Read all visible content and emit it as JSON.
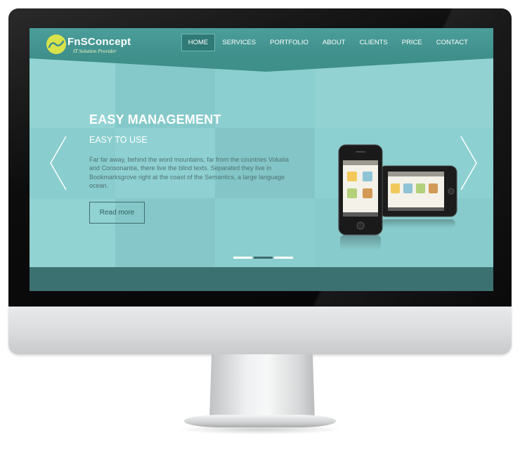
{
  "brand": {
    "name": "FnSConcept",
    "tagline": "IT Solution Provider",
    "accent": "#d8e24a"
  },
  "nav": {
    "items": [
      {
        "label": "HOME",
        "active": true
      },
      {
        "label": "SERVICES",
        "active": false
      },
      {
        "label": "PORTFOLIO",
        "active": false
      },
      {
        "label": "ABOUT",
        "active": false
      },
      {
        "label": "CLIENTS",
        "active": false
      },
      {
        "label": "PRICE",
        "active": false
      },
      {
        "label": "CONTACT",
        "active": false
      }
    ]
  },
  "hero": {
    "title": "EASY MANAGEMENT",
    "subtitle": "EASY TO USE",
    "text": "Far far away, behind the word mountains, far from the countries Vokalia and Consonantia, there live the blind texts. Separated they live in Bookmarksgrove right at the coast of the Semantics, a large language ocean.",
    "button_label": "Read more",
    "slider": {
      "total": 3,
      "active_index": 1
    },
    "prev_icon": "chevron-left-icon",
    "next_icon": "chevron-right-icon"
  },
  "colors": {
    "nav_background": "#3f8f8b",
    "hero_background": "#8ed0d1",
    "footer_band": "#3c7171",
    "heading_text": "#ffffff",
    "body_text": "#4f7274"
  }
}
